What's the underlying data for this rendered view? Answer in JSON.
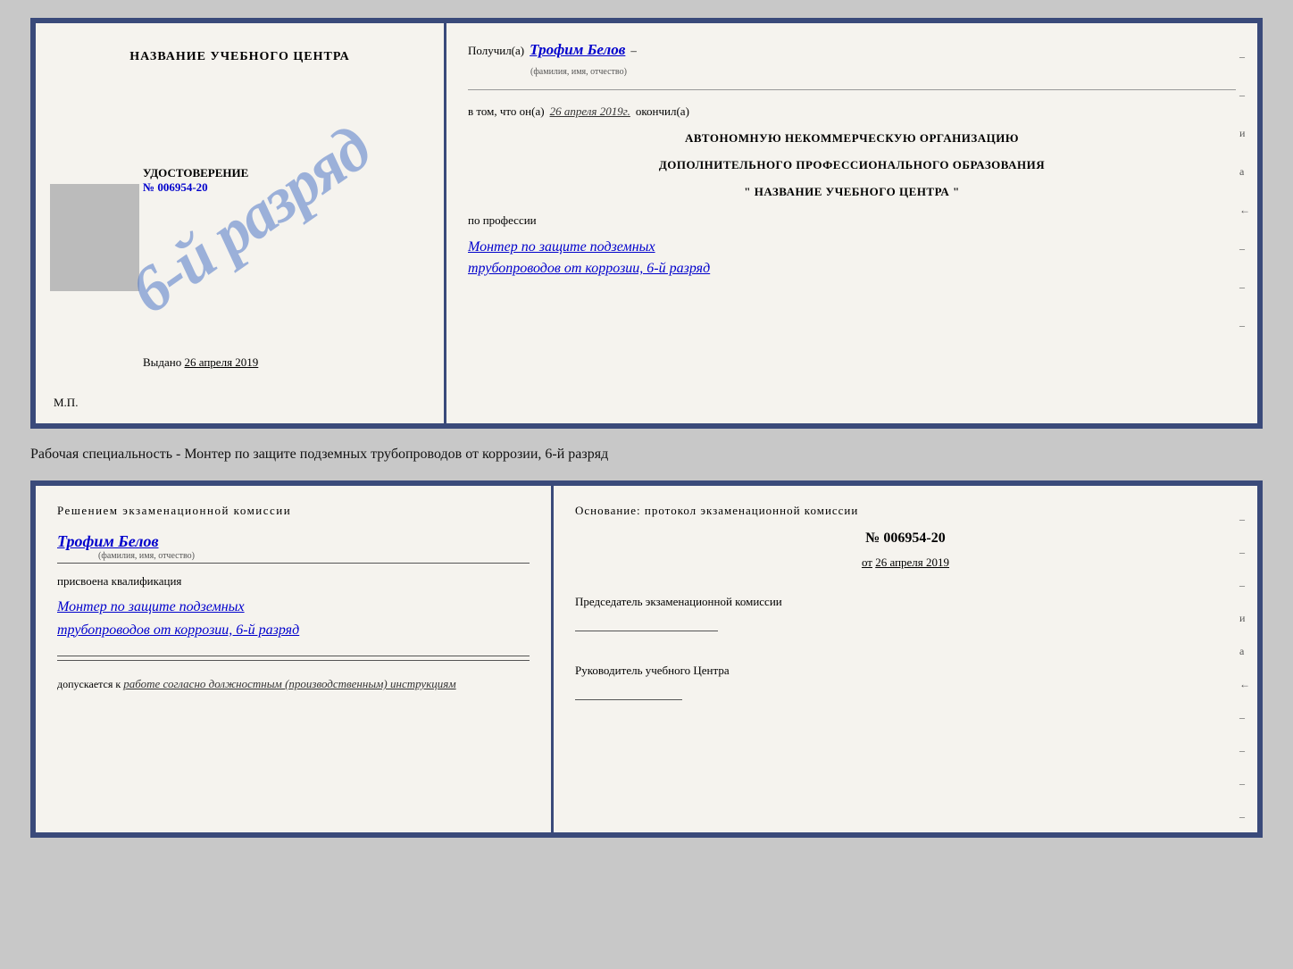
{
  "top_cert": {
    "left": {
      "title": "НАЗВАНИЕ УЧЕБНОГО ЦЕНТРА",
      "stamp_text": "6-й разряд",
      "udost_label": "УДОСТОВЕРЕНИЕ",
      "udost_number": "№ 006954-20",
      "vydano_label": "Выдано",
      "vydano_date": "26 апреля 2019",
      "mp_label": "М.П."
    },
    "right": {
      "poluchil_label": "Получил(а)",
      "name": "Трофим Белов",
      "name_sublabel": "(фамилия, имя, отчество)",
      "dash1": "–",
      "vtom_label": "в том, что он(а)",
      "date": "26 апреля 2019г.",
      "okonchil_label": "окончил(а)",
      "org_line1": "АВТОНОМНУЮ НЕКОММЕРЧЕСКУЮ ОРГАНИЗАЦИЮ",
      "org_line2": "ДОПОЛНИТЕЛЬНОГО ПРОФЕССИОНАЛЬНОГО ОБРАЗОВАНИЯ",
      "org_line3": "\"  НАЗВАНИЕ УЧЕБНОГО ЦЕНТРА  \"",
      "po_professii": "по профессии",
      "profession_line1": "Монтер по защите подземных",
      "profession_line2": "трубопроводов от коррозии, 6-й разряд",
      "side_marks": [
        "–",
        "–",
        "и",
        "а",
        "←",
        "–",
        "–",
        "–"
      ]
    }
  },
  "middle_text": "Рабочая специальность - Монтер по защите подземных трубопроводов от коррозии, 6-й разряд",
  "bottom_cert": {
    "left": {
      "title": "Решением экзаменационной комиссии",
      "name": "Трофим Белов",
      "name_sublabel": "(фамилия, имя, отчество)",
      "prisvoena_label": "присвоена квалификация",
      "profession_line1": "Монтер по защите подземных",
      "profession_line2": "трубопроводов от коррозии, 6-й разряд",
      "dopuskaetsya_label": "допускается к",
      "dopuskaetsya_val": "работе согласно должностным (производственным) инструкциям"
    },
    "right": {
      "osnovanie_label": "Основание: протокол экзаменационной комиссии",
      "number": "№  006954-20",
      "ot_label": "от",
      "ot_date": "26 апреля 2019",
      "chair_label": "Председатель экзаменационной комиссии",
      "rukov_label": "Руководитель учебного Центра",
      "side_marks": [
        "–",
        "–",
        "–",
        "и",
        "а",
        "←",
        "–",
        "–",
        "–",
        "–"
      ]
    }
  }
}
